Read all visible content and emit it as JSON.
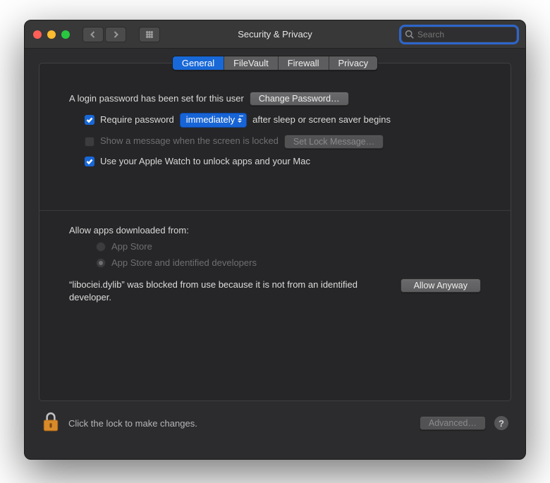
{
  "window": {
    "title": "Security & Privacy"
  },
  "search": {
    "placeholder": "Search"
  },
  "tabs": [
    {
      "label": "General",
      "active": true
    },
    {
      "label": "FileVault",
      "active": false
    },
    {
      "label": "Firewall",
      "active": false
    },
    {
      "label": "Privacy",
      "active": false
    }
  ],
  "login": {
    "has_password": "A login password has been set for this user",
    "change_button": "Change Password…",
    "require_label_pre": "Require password",
    "require_select": "immediately",
    "require_label_post": "after sleep or screen saver begins",
    "show_message": "Show a message when the screen is locked",
    "set_lock_button": "Set Lock Message…",
    "apple_watch": "Use your Apple Watch to unlock apps and your Mac"
  },
  "download": {
    "heading": "Allow apps downloaded from:",
    "opt_appstore": "App Store",
    "opt_identified": "App Store and identified developers",
    "blocked_text": "“libociei.dylib” was blocked from use because it is not from an identified developer.",
    "allow_button": "Allow Anyway"
  },
  "footer": {
    "lock_text": "Click the lock to make changes.",
    "advanced_button": "Advanced…"
  }
}
